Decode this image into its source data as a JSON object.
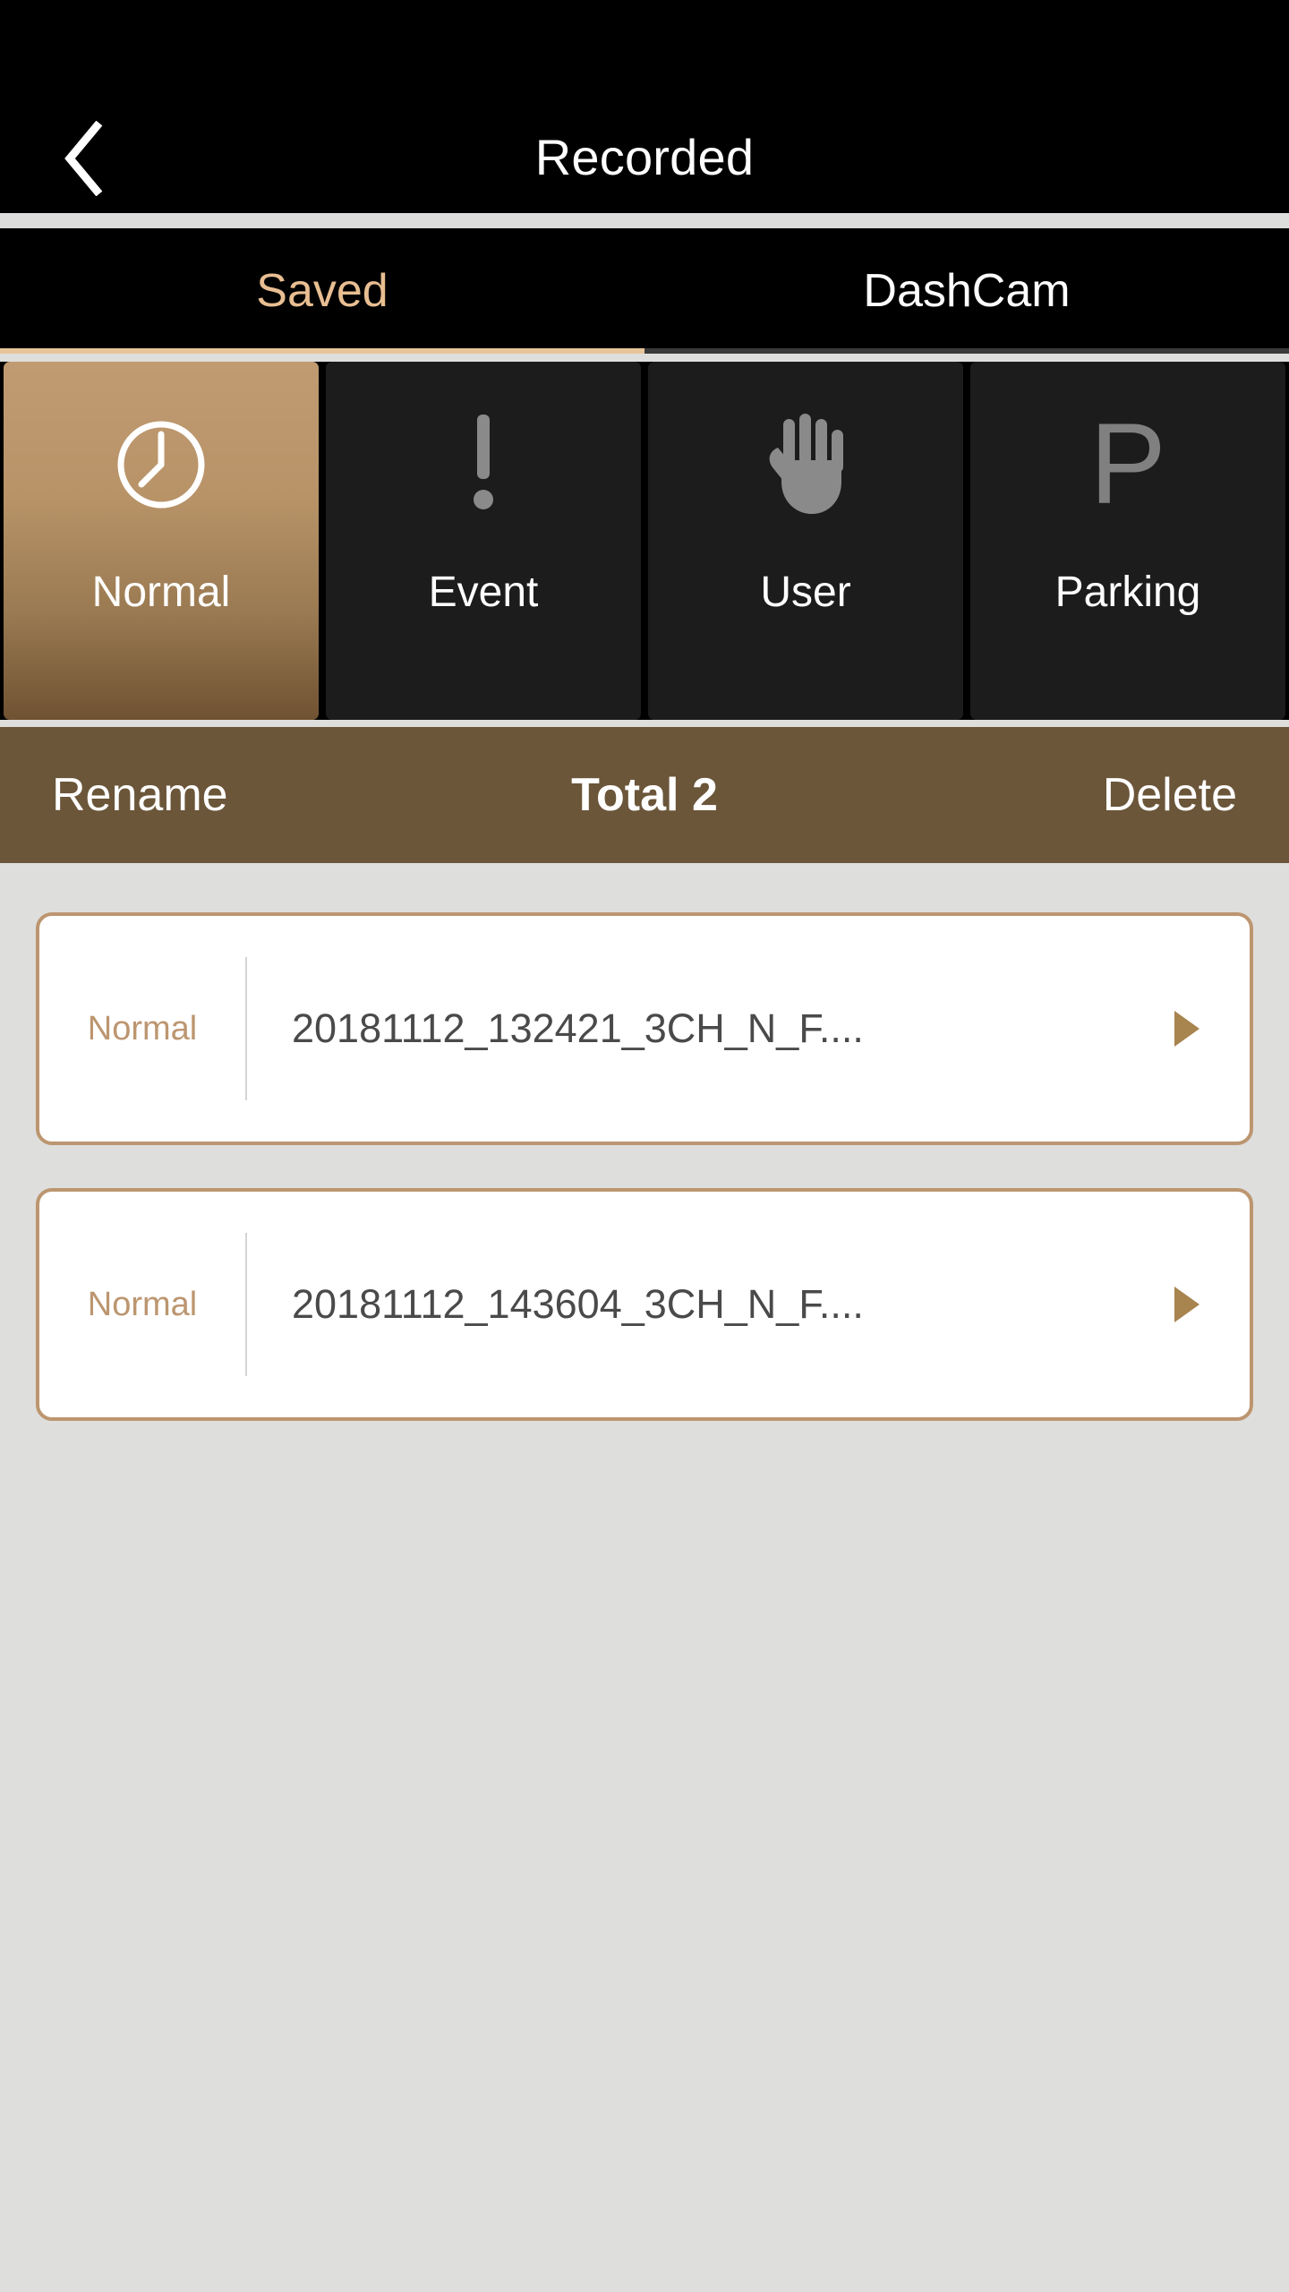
{
  "header": {
    "title": "Recorded",
    "back_icon": "chevron-left-icon"
  },
  "tabs": [
    {
      "label": "Saved",
      "active": true
    },
    {
      "label": "DashCam",
      "active": false
    }
  ],
  "categories": [
    {
      "label": "Normal",
      "icon": "clock-icon",
      "selected": true
    },
    {
      "label": "Event",
      "icon": "exclamation-icon",
      "selected": false
    },
    {
      "label": "User",
      "icon": "hand-icon",
      "selected": false
    },
    {
      "label": "Parking",
      "icon": "parking-p-icon",
      "selected": false
    }
  ],
  "actionbar": {
    "rename_label": "Rename",
    "total_label": "Total 2",
    "delete_label": "Delete"
  },
  "files": [
    {
      "kind": "Normal",
      "name": "20181112_132421_3CH_N_F....",
      "play_icon": "play-icon"
    },
    {
      "kind": "Normal",
      "name": "20181112_143604_3CH_N_F....",
      "play_icon": "play-icon"
    }
  ],
  "colors": {
    "accent_tan": "#BC9670",
    "tab_active": "#E8BE92",
    "actionbar_bg": "#6B563A",
    "tile_dark": "#1C1C1C",
    "page_bg": "#DEDEDC",
    "filename": "#4A4A4A",
    "play_arrow": "#A8844F"
  }
}
